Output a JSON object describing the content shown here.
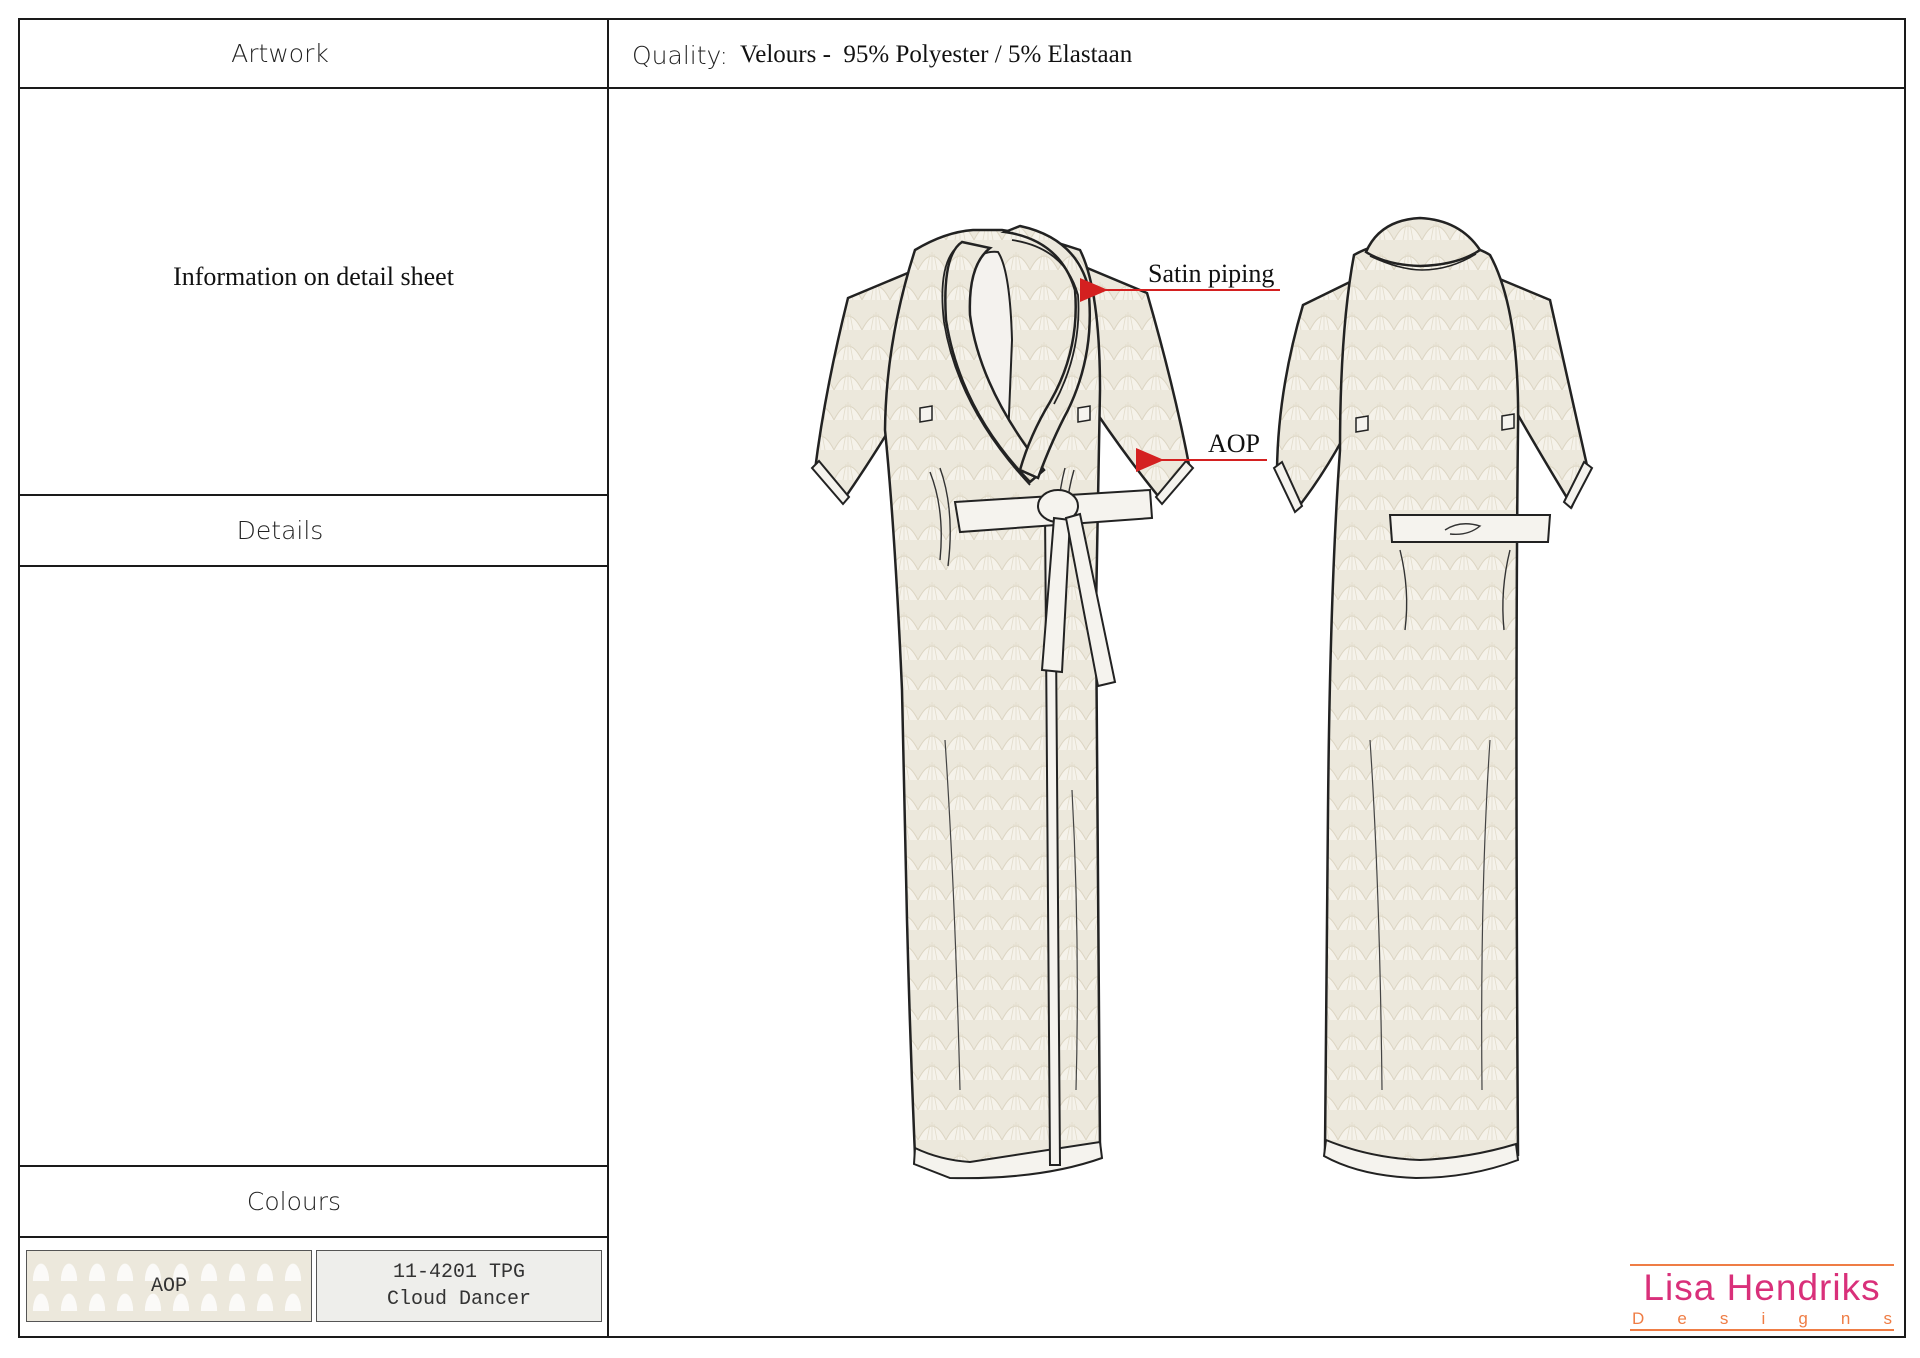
{
  "artwork": {
    "header": "Artwork",
    "info_text": "Information on detail sheet"
  },
  "quality": {
    "label": "Quality:",
    "value": "Velours -  95% Polyester / 5% Elastaan"
  },
  "details": {
    "header": "Details"
  },
  "colours": {
    "header": "Colours",
    "swatches": [
      {
        "label": "AOP",
        "color": "#ece8dc"
      },
      {
        "line1": "11-4201 TPG",
        "line2": "Cloud Dancer",
        "color": "#eeeeeb"
      }
    ]
  },
  "drawing": {
    "callouts": [
      {
        "label": "Satin piping",
        "arrow_color": "#d42020"
      },
      {
        "label": "AOP",
        "arrow_color": "#d42020"
      }
    ],
    "fabric_color": "#ece8dc"
  },
  "logo": {
    "name": "Lisa Hendriks",
    "sub": [
      "D",
      "e",
      "s",
      "i",
      "g",
      "n",
      "s"
    ],
    "name_color": "#d9307a",
    "accent_color": "#ef7d45"
  }
}
